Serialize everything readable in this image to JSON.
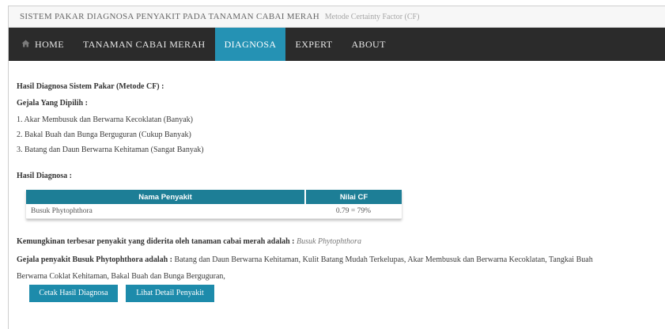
{
  "header": {
    "title": "SISTEM PAKAR DIAGNOSA PENYAKIT PADA TANAMAN CABAI MERAH",
    "subtitle": "Metode Certainty Factor (CF)"
  },
  "nav": {
    "items": [
      {
        "label": "HOME",
        "icon": "home-icon"
      },
      {
        "label": "TANAMAN CABAI MERAH"
      },
      {
        "label": "DIAGNOSA",
        "active": true
      },
      {
        "label": "EXPERT"
      },
      {
        "label": "ABOUT"
      }
    ],
    "active_color": "#2592b4",
    "bar_color": "#2b2b2b"
  },
  "main": {
    "heading": "Hasil Diagnosa Sistem Pakar (Metode CF) :",
    "symptoms_heading": "Gejala Yang Dipilih :",
    "symptoms": [
      "1. Akar Membusuk dan Berwarna Kecoklatan (Banyak)",
      "2. Bakal Buah dan Bunga Berguguran (Cukup Banyak)",
      "3. Batang dan Daun Berwarna Kehitaman (Sangat Banyak)"
    ],
    "result_heading": "Hasil Diagnosa :",
    "table": {
      "headers": [
        "Nama Penyakit",
        "Nilai CF"
      ],
      "rows": [
        [
          "Busuk Phytophthora",
          "0.79 = 79%"
        ]
      ],
      "header_color": "#1d7e96"
    },
    "conclusion_label": "Kemungkinan terbesar penyakit yang diderita oleh tanaman cabai merah adalah :",
    "conclusion_value": "Busuk Phytophthora",
    "symptoms_detail_label": "Gejala penyakit Busuk Phytophthora adalah :",
    "symptoms_detail_line1": "Batang dan Daun Berwarna Kehitaman, Kulit Batang Mudah Terkelupas, Akar Membusuk dan Berwarna Kecoklatan, Tangkai Buah",
    "symptoms_detail_line2": "Berwarna Coklat Kehitaman, Bakal Buah dan Bunga Berguguran,",
    "buttons": {
      "print_label": "Cetak Hasil Diagnosa",
      "detail_label": "Lihat Detail Penyakit"
    }
  }
}
